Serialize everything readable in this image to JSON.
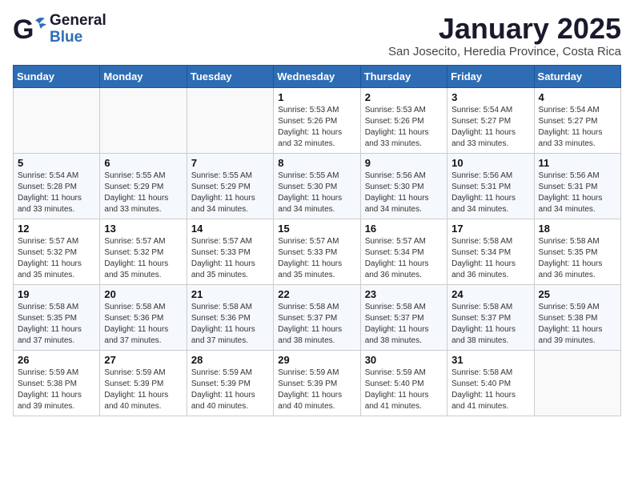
{
  "logo": {
    "general": "General",
    "blue": "Blue"
  },
  "title": "January 2025",
  "subtitle": "San Josecito, Heredia Province, Costa Rica",
  "days": [
    "Sunday",
    "Monday",
    "Tuesday",
    "Wednesday",
    "Thursday",
    "Friday",
    "Saturday"
  ],
  "weeks": [
    [
      {
        "day": "",
        "info": ""
      },
      {
        "day": "",
        "info": ""
      },
      {
        "day": "",
        "info": ""
      },
      {
        "day": "1",
        "info": "Sunrise: 5:53 AM\nSunset: 5:26 PM\nDaylight: 11 hours\nand 32 minutes."
      },
      {
        "day": "2",
        "info": "Sunrise: 5:53 AM\nSunset: 5:26 PM\nDaylight: 11 hours\nand 33 minutes."
      },
      {
        "day": "3",
        "info": "Sunrise: 5:54 AM\nSunset: 5:27 PM\nDaylight: 11 hours\nand 33 minutes."
      },
      {
        "day": "4",
        "info": "Sunrise: 5:54 AM\nSunset: 5:27 PM\nDaylight: 11 hours\nand 33 minutes."
      }
    ],
    [
      {
        "day": "5",
        "info": "Sunrise: 5:54 AM\nSunset: 5:28 PM\nDaylight: 11 hours\nand 33 minutes."
      },
      {
        "day": "6",
        "info": "Sunrise: 5:55 AM\nSunset: 5:29 PM\nDaylight: 11 hours\nand 33 minutes."
      },
      {
        "day": "7",
        "info": "Sunrise: 5:55 AM\nSunset: 5:29 PM\nDaylight: 11 hours\nand 34 minutes."
      },
      {
        "day": "8",
        "info": "Sunrise: 5:55 AM\nSunset: 5:30 PM\nDaylight: 11 hours\nand 34 minutes."
      },
      {
        "day": "9",
        "info": "Sunrise: 5:56 AM\nSunset: 5:30 PM\nDaylight: 11 hours\nand 34 minutes."
      },
      {
        "day": "10",
        "info": "Sunrise: 5:56 AM\nSunset: 5:31 PM\nDaylight: 11 hours\nand 34 minutes."
      },
      {
        "day": "11",
        "info": "Sunrise: 5:56 AM\nSunset: 5:31 PM\nDaylight: 11 hours\nand 34 minutes."
      }
    ],
    [
      {
        "day": "12",
        "info": "Sunrise: 5:57 AM\nSunset: 5:32 PM\nDaylight: 11 hours\nand 35 minutes."
      },
      {
        "day": "13",
        "info": "Sunrise: 5:57 AM\nSunset: 5:32 PM\nDaylight: 11 hours\nand 35 minutes."
      },
      {
        "day": "14",
        "info": "Sunrise: 5:57 AM\nSunset: 5:33 PM\nDaylight: 11 hours\nand 35 minutes."
      },
      {
        "day": "15",
        "info": "Sunrise: 5:57 AM\nSunset: 5:33 PM\nDaylight: 11 hours\nand 35 minutes."
      },
      {
        "day": "16",
        "info": "Sunrise: 5:57 AM\nSunset: 5:34 PM\nDaylight: 11 hours\nand 36 minutes."
      },
      {
        "day": "17",
        "info": "Sunrise: 5:58 AM\nSunset: 5:34 PM\nDaylight: 11 hours\nand 36 minutes."
      },
      {
        "day": "18",
        "info": "Sunrise: 5:58 AM\nSunset: 5:35 PM\nDaylight: 11 hours\nand 36 minutes."
      }
    ],
    [
      {
        "day": "19",
        "info": "Sunrise: 5:58 AM\nSunset: 5:35 PM\nDaylight: 11 hours\nand 37 minutes."
      },
      {
        "day": "20",
        "info": "Sunrise: 5:58 AM\nSunset: 5:36 PM\nDaylight: 11 hours\nand 37 minutes."
      },
      {
        "day": "21",
        "info": "Sunrise: 5:58 AM\nSunset: 5:36 PM\nDaylight: 11 hours\nand 37 minutes."
      },
      {
        "day": "22",
        "info": "Sunrise: 5:58 AM\nSunset: 5:37 PM\nDaylight: 11 hours\nand 38 minutes."
      },
      {
        "day": "23",
        "info": "Sunrise: 5:58 AM\nSunset: 5:37 PM\nDaylight: 11 hours\nand 38 minutes."
      },
      {
        "day": "24",
        "info": "Sunrise: 5:58 AM\nSunset: 5:37 PM\nDaylight: 11 hours\nand 38 minutes."
      },
      {
        "day": "25",
        "info": "Sunrise: 5:59 AM\nSunset: 5:38 PM\nDaylight: 11 hours\nand 39 minutes."
      }
    ],
    [
      {
        "day": "26",
        "info": "Sunrise: 5:59 AM\nSunset: 5:38 PM\nDaylight: 11 hours\nand 39 minutes."
      },
      {
        "day": "27",
        "info": "Sunrise: 5:59 AM\nSunset: 5:39 PM\nDaylight: 11 hours\nand 40 minutes."
      },
      {
        "day": "28",
        "info": "Sunrise: 5:59 AM\nSunset: 5:39 PM\nDaylight: 11 hours\nand 40 minutes."
      },
      {
        "day": "29",
        "info": "Sunrise: 5:59 AM\nSunset: 5:39 PM\nDaylight: 11 hours\nand 40 minutes."
      },
      {
        "day": "30",
        "info": "Sunrise: 5:59 AM\nSunset: 5:40 PM\nDaylight: 11 hours\nand 41 minutes."
      },
      {
        "day": "31",
        "info": "Sunrise: 5:58 AM\nSunset: 5:40 PM\nDaylight: 11 hours\nand 41 minutes."
      },
      {
        "day": "",
        "info": ""
      }
    ]
  ]
}
